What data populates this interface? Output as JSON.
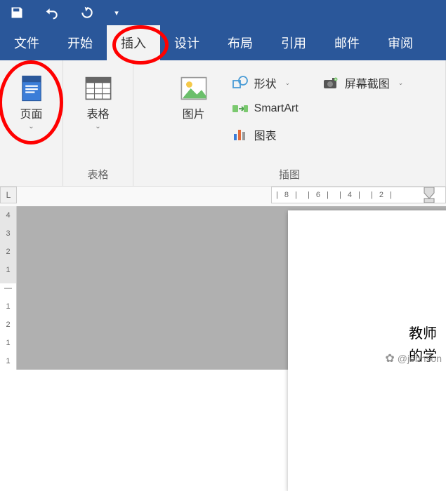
{
  "qat": {
    "save": "save-icon",
    "undo": "undo-icon",
    "redo": "redo-icon",
    "more": "▾"
  },
  "tabs": {
    "items": [
      {
        "label": "文件"
      },
      {
        "label": "开始"
      },
      {
        "label": "插入"
      },
      {
        "label": "设计"
      },
      {
        "label": "布局"
      },
      {
        "label": "引用"
      },
      {
        "label": "邮件"
      },
      {
        "label": "审阅"
      }
    ],
    "active_index": 2
  },
  "ribbon": {
    "pages": {
      "label": "页面"
    },
    "tables_group": {
      "label": "表格"
    },
    "tables": {
      "label": "表格"
    },
    "illustrations_group": {
      "label": "插图"
    },
    "picture": {
      "label": "图片"
    },
    "shapes": {
      "label": "形状"
    },
    "smartart": {
      "label": "SmartArt"
    },
    "chart": {
      "label": "图表"
    },
    "screenshot": {
      "label": "屏幕截图"
    }
  },
  "ruler": {
    "h_labels": [
      "8",
      "6",
      "4",
      "2"
    ],
    "v_labels": [
      "4",
      "3",
      "2",
      "1",
      "1",
      "2",
      "1",
      "1"
    ]
  },
  "document": {
    "text_line1": "教师",
    "text_line2": "的学"
  },
  "watermark": {
    "text": "@johnson"
  }
}
